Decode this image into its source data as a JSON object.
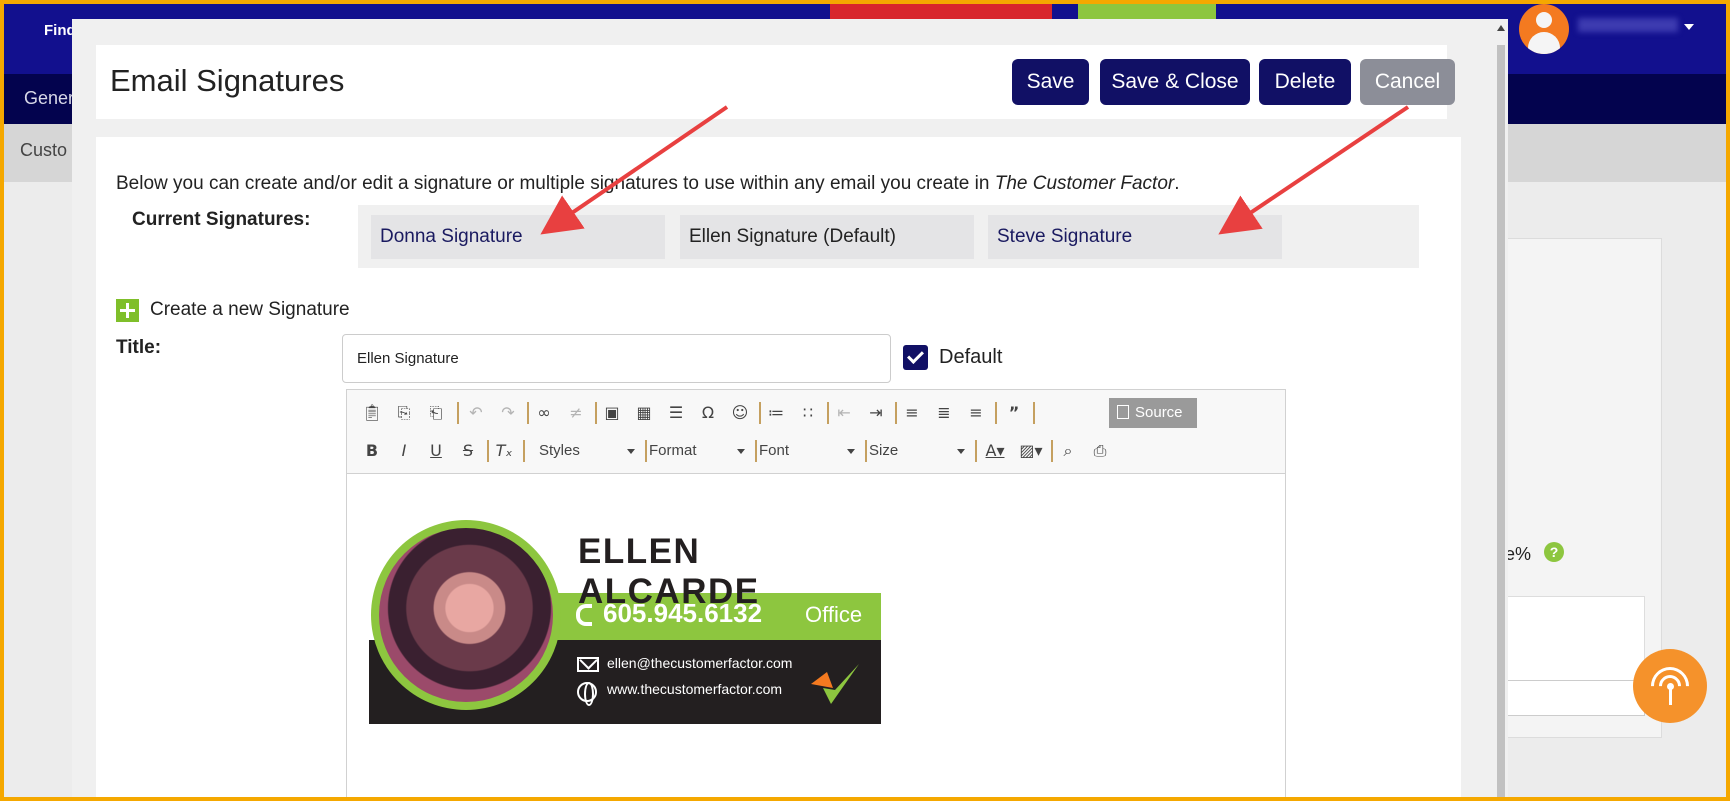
{
  "background": {
    "find_label": "Find",
    "nav_label": "Gener",
    "sub_label": "Custo",
    "side_text": "e%",
    "help_label": "?"
  },
  "modal": {
    "title": "Email Signatures",
    "buttons": {
      "save": "Save",
      "save_close": "Save & Close",
      "delete": "Delete",
      "cancel": "Cancel"
    },
    "intro_text": "Below you can create and/or edit a signature or multiple signatures to use within any email you create in ",
    "intro_brand": "The Customer Factor",
    "intro_end": ".",
    "current_label": "Current Signatures:",
    "signatures": [
      {
        "label": "Donna Signature"
      },
      {
        "label": "Ellen Signature (Default)"
      },
      {
        "label": "Steve Signature"
      }
    ],
    "create_label": "Create a new Signature",
    "title_label": "Title:",
    "title_value": "Ellen Signature",
    "default_label": "Default",
    "default_checked": true
  },
  "editor": {
    "source_label": "Source",
    "combos": {
      "styles": "Styles",
      "format": "Format",
      "font": "Font",
      "size": "Size"
    },
    "signature": {
      "name": "ELLEN ALCARDE",
      "phone": "605.945.6132",
      "phone_type": "Office",
      "email": "ellen@thecustomerfactor.com",
      "website": "www.thecustomerfactor.com"
    }
  },
  "colors": {
    "navy": "#111065",
    "accent_green": "#8dc63f",
    "border_orange": "#f5a800",
    "annotation_red": "#e84040"
  }
}
